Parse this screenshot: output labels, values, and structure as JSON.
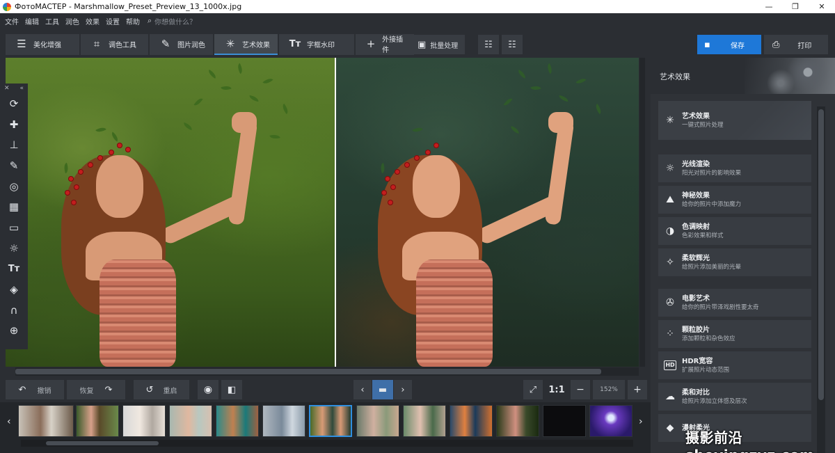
{
  "window": {
    "title": "ФотоМАСТЕР - Marshmallow_Preset_Preview_13_1000x.jpg",
    "minimize": "—",
    "maximize": "❐",
    "close": "✕"
  },
  "menu": {
    "items": [
      "文件",
      "编辑",
      "工具",
      "润色",
      "效果",
      "设置",
      "帮助"
    ],
    "search_placeholder": "你想做什么？"
  },
  "tabs": [
    {
      "label": "美化增强",
      "icon": "sliders-icon"
    },
    {
      "label": "调色工具",
      "icon": "crop-icon"
    },
    {
      "label": "图片润色",
      "icon": "brush-icon"
    },
    {
      "label": "艺术效果",
      "icon": "magic-wand-icon",
      "active": true
    },
    {
      "label": "字框水印",
      "icon": "text-icon"
    },
    {
      "label": "外接插件",
      "icon": "plus-icon"
    }
  ],
  "toolbar": {
    "batch_label": "批量处理",
    "save_label": "保存",
    "print_label": "打印"
  },
  "bottom": {
    "undo_label": "撤销",
    "redo_label": "恢复",
    "reset_label": "重启",
    "ratio_label": "1:1",
    "zoom_value": "152%"
  },
  "panel": {
    "title": "艺术效果",
    "items": [
      {
        "name": "艺术效果",
        "desc": "一键式照片处理",
        "icon": "magic-wand-icon"
      },
      {
        "name": "光线渲染",
        "desc": "阳光对照片的影响效果",
        "icon": "sun-icon"
      },
      {
        "name": "神秘效果",
        "desc": "给你的照片中添加魔力",
        "icon": "landscape-icon"
      },
      {
        "name": "色调映射",
        "desc": "色彩效果和样式",
        "icon": "contrast-icon"
      },
      {
        "name": "柔软辉光",
        "desc": "给照片添加美丽的光晕",
        "icon": "sparkle-icon"
      },
      {
        "name": "电影艺术",
        "desc": "给你的照片带泽戏剧性要太奇",
        "icon": "film-reel-icon"
      },
      {
        "name": "颗粒胶片",
        "desc": "添加颗粒和杂色效应",
        "icon": "grain-icon"
      },
      {
        "name": "HDR宽容",
        "desc": "扩展照片动态范围",
        "icon": "hdr-icon"
      },
      {
        "name": "柔和对比",
        "desc": "给照片添加立体感及层次",
        "icon": "soft-contrast-icon"
      },
      {
        "name": "漫射柔光",
        "desc": "",
        "icon": "drop-icon"
      }
    ]
  },
  "watermark": "摄影前沿 sheyingzyz.com",
  "colors": {
    "accent": "#1e78d8",
    "selected_border": "#2f8fe0",
    "bg": "#2b2e33"
  }
}
